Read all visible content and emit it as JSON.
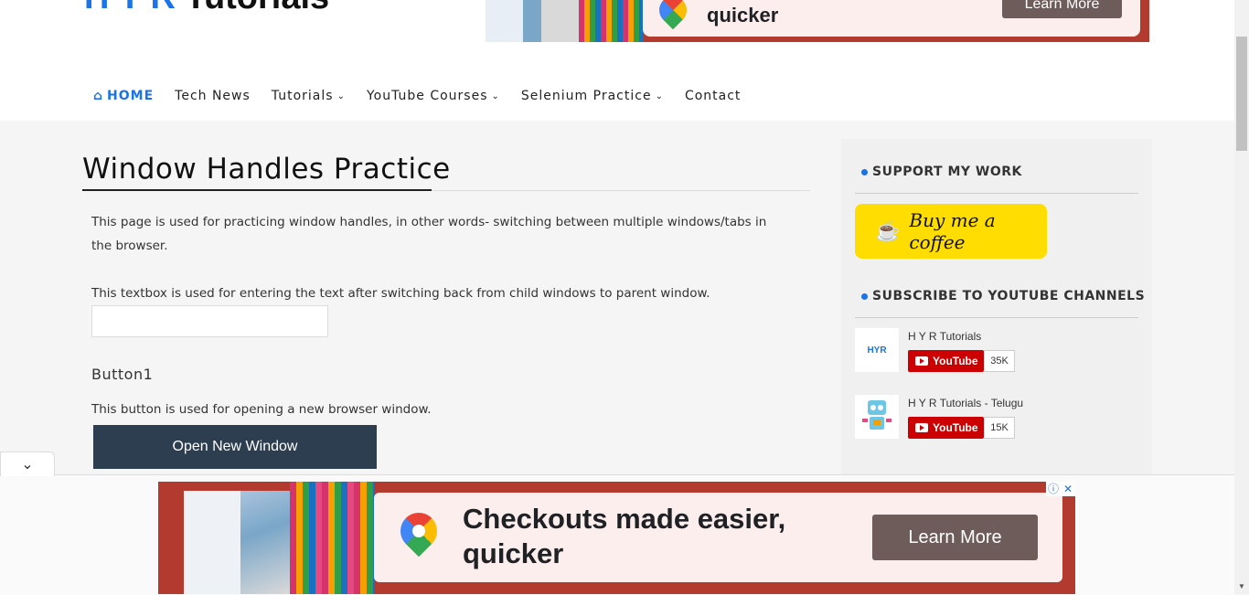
{
  "logo": {
    "left": "H Y R",
    "right": "Tutorials"
  },
  "top_ad": {
    "headline": "quicker",
    "button": "Learn More"
  },
  "nav": {
    "items": [
      {
        "label": "HOME",
        "icon": "home-icon",
        "active": true
      },
      {
        "label": "Tech News"
      },
      {
        "label": "Tutorials",
        "dropdown": true
      },
      {
        "label": "YouTube Courses",
        "dropdown": true
      },
      {
        "label": "Selenium Practice",
        "dropdown": true
      },
      {
        "label": "Contact"
      }
    ]
  },
  "main": {
    "title": "Window Handles Practice",
    "intro": "This page is used for practicing window handles, in other words- switching between multiple windows/tabs in the browser.",
    "textbox_info": "This textbox is used for entering the text after switching back from child windows to parent window.",
    "textbox_value": "",
    "button1_heading": "Button1",
    "button1_info": "This button is used for opening a new browser window.",
    "button1_label": "Open New Window"
  },
  "sidebar": {
    "support_heading": "SUPPORT MY WORK",
    "coffee_label": "Buy me a coffee",
    "subscribe_heading": "SUBSCRIBE TO YOUTUBE CHANNELS",
    "channels": [
      {
        "name": "H Y R Tutorials",
        "button": "YouTube",
        "count": "35K",
        "avatar_text": "HYR"
      },
      {
        "name": "H Y R Tutorials - Telugu",
        "button": "YouTube",
        "count": "15K"
      }
    ]
  },
  "bottom_ad": {
    "headline": "Checkouts made easier, quicker",
    "button": "Learn More"
  },
  "colors": {
    "accent": "#1a73e8",
    "button": "#2c3e50",
    "coffee": "#ffdd00",
    "youtube": "#cc0000"
  }
}
